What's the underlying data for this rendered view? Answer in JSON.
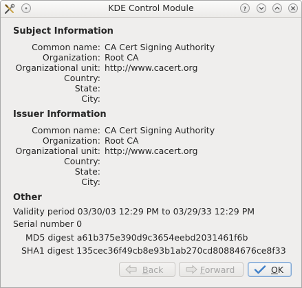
{
  "window": {
    "title": "KDE Control Module"
  },
  "subject": {
    "heading": "Subject Information",
    "fields": [
      {
        "label": "Common name:",
        "value": "CA Cert Signing Authority"
      },
      {
        "label": "Organization:",
        "value": "Root CA"
      },
      {
        "label": "Organizational unit:",
        "value": "http://www.cacert.org"
      },
      {
        "label": "Country:",
        "value": ""
      },
      {
        "label": "State:",
        "value": ""
      },
      {
        "label": "City:",
        "value": ""
      }
    ]
  },
  "issuer": {
    "heading": "Issuer Information",
    "fields": [
      {
        "label": "Common name:",
        "value": "CA Cert Signing Authority"
      },
      {
        "label": "Organization:",
        "value": "Root CA"
      },
      {
        "label": "Organizational unit:",
        "value": "http://www.cacert.org"
      },
      {
        "label": "Country:",
        "value": ""
      },
      {
        "label": "State:",
        "value": ""
      },
      {
        "label": "City:",
        "value": ""
      }
    ]
  },
  "other": {
    "heading": "Other",
    "validity": "Validity period 03/30/03 12:29 PM to 03/29/33 12:29 PM",
    "serial": "Serial number 0",
    "md5": "MD5 digest a61b375e390d9c3654eebd2031461f6b",
    "sha1": "SHA1 digest 135cec36f49cb8e93b1ab270cd80884676ce8f33"
  },
  "buttons": {
    "back_prefix": "B",
    "back_rest": "ack",
    "forward_prefix": "F",
    "forward_rest": "orward",
    "ok_prefix": "O",
    "ok_rest": "K"
  },
  "colors": {
    "window_bg": "#efeeed",
    "ok_border": "#7fa6d3",
    "ok_check": "#3f7fc8"
  }
}
